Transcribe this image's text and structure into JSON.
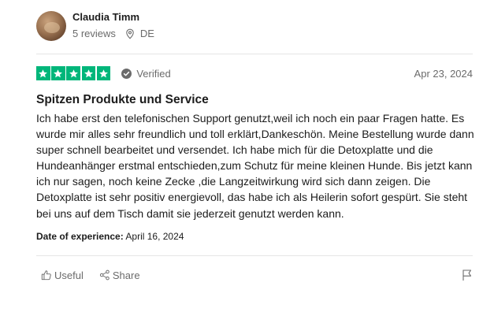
{
  "reviewer": {
    "name": "Claudia Timm",
    "reviews_count": "5 reviews",
    "country": "DE"
  },
  "rating": {
    "stars": 5,
    "max": 5,
    "star_color": "#00b67a",
    "verified_label": "Verified"
  },
  "review": {
    "date": "Apr 23, 2024",
    "title": "Spitzen Produkte und Service",
    "body": "Ich habe erst den telefonischen Support genutzt,weil ich noch ein paar Fragen hatte. Es wurde mir alles sehr freundlich und toll erklärt,Dankeschön. Meine Bestellung wurde dann super schnell bearbeitet und versendet. Ich habe mich für die Detoxplatte und die Hundeanhänger erstmal entschieden,zum Schutz für meine kleinen Hunde. Bis jetzt kann ich nur sagen, noch keine Zecke ,die Langzeitwirkung wird sich dann zeigen. Die Detoxplatte ist sehr positiv energievoll, das habe ich als Heilerin sofort gespürt. Sie steht bei uns auf dem Tisch damit sie jederzeit genutzt werden kann.",
    "experience_label": "Date of experience:",
    "experience_date": "April 16, 2024"
  },
  "actions": {
    "useful_label": "Useful",
    "share_label": "Share"
  },
  "icons": {
    "location": "location-pin-icon",
    "verified": "verified-check-icon",
    "useful": "thumbs-up-icon",
    "share": "share-icon",
    "report": "flag-icon"
  }
}
